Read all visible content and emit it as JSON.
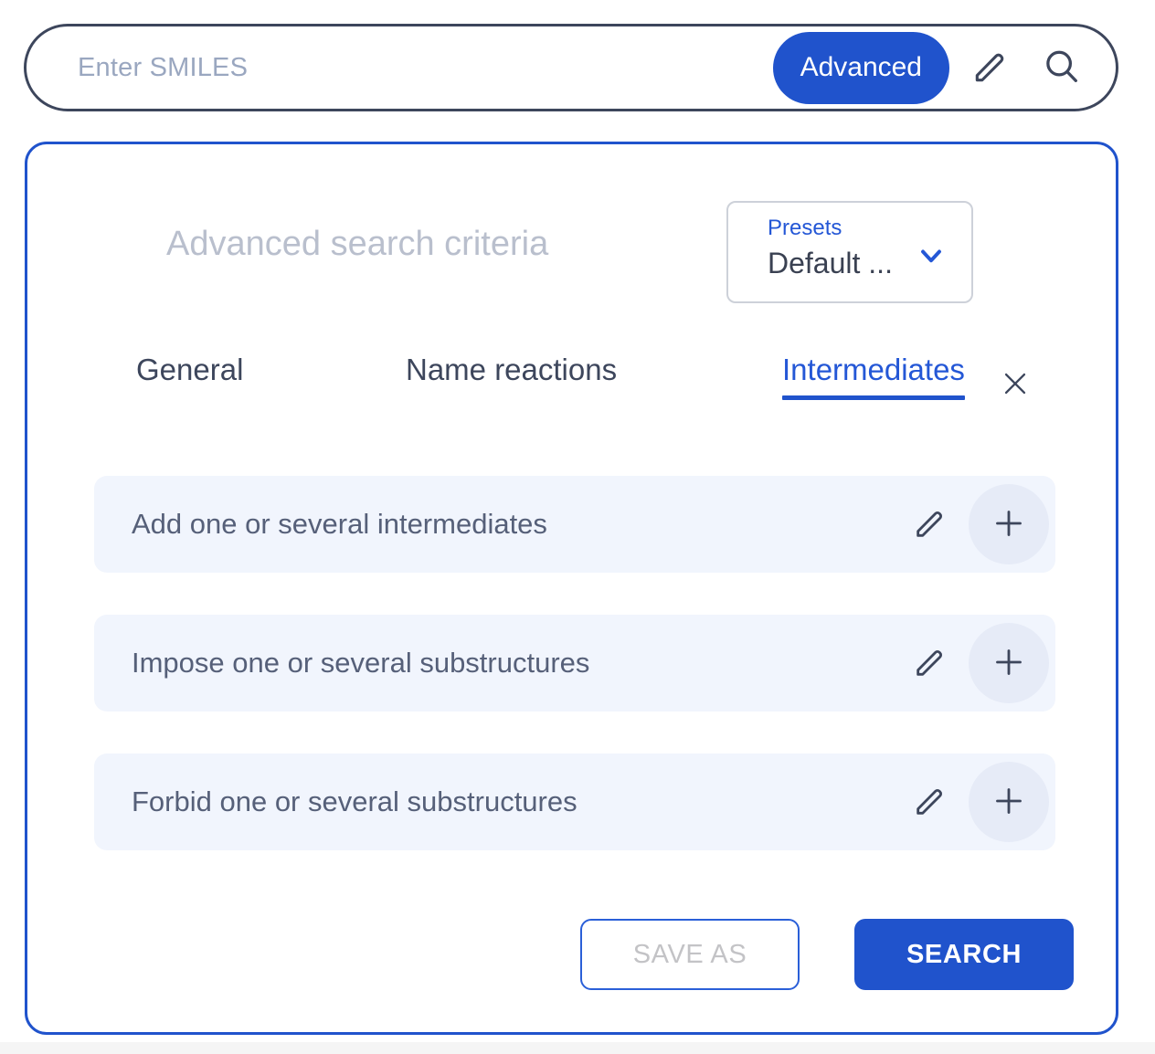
{
  "search_bar": {
    "placeholder": "Enter SMILES",
    "value": "",
    "advanced_label": "Advanced",
    "pencil_icon": "pencil-icon",
    "search_icon": "search-icon"
  },
  "panel": {
    "title": "Advanced search criteria",
    "presets": {
      "label": "Presets",
      "value": "Default ...",
      "chevron_icon": "chevron-down-icon"
    },
    "close_icon": "close-icon",
    "tabs": [
      {
        "label": "General",
        "active": false
      },
      {
        "label": "Name reactions",
        "active": false
      },
      {
        "label": "Intermediates",
        "active": true
      }
    ],
    "criteria_rows": [
      {
        "label": "Add one or several intermediates",
        "pencil_icon": "pencil-icon",
        "add_icon": "plus-icon"
      },
      {
        "label": "Impose one or several substructures",
        "pencil_icon": "pencil-icon",
        "add_icon": "plus-icon"
      },
      {
        "label": "Forbid one or several substructures",
        "pencil_icon": "pencil-icon",
        "add_icon": "plus-icon"
      }
    ],
    "footer": {
      "save_as_label": "SAVE AS",
      "search_label": "SEARCH"
    }
  },
  "colors": {
    "accent_blue": "#2053cc",
    "link_blue": "#2457d6",
    "dark_slate": "#3d465c",
    "muted_title": "#b9bfcd",
    "row_bg": "#f1f5fd",
    "plus_circle": "#e6ebf7",
    "disabled_text": "#c3c3c6"
  }
}
